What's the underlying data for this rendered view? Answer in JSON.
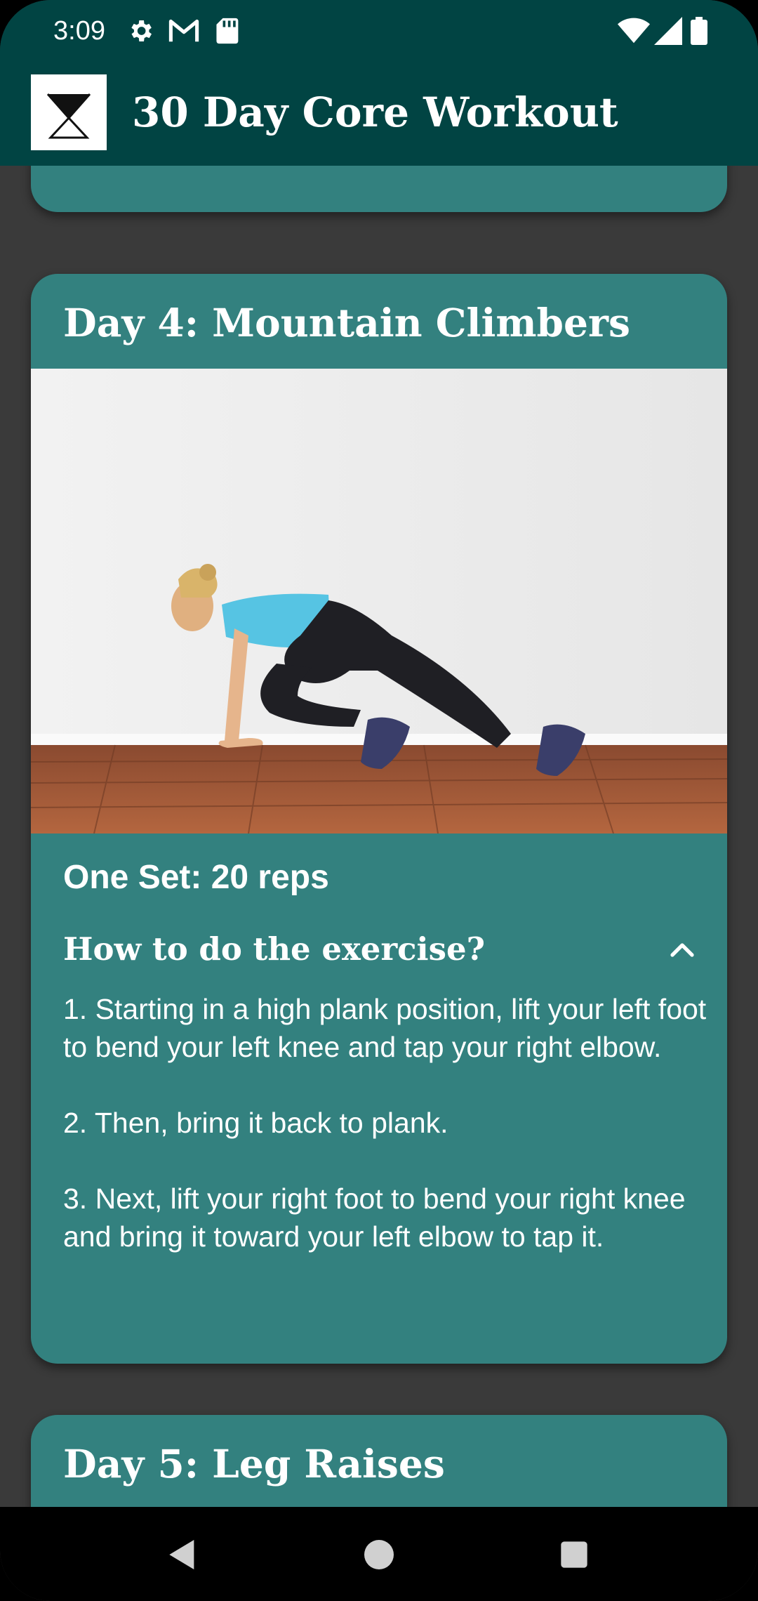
{
  "status_bar": {
    "time": "3:09",
    "left_icons": [
      "gear-icon",
      "gmail-icon",
      "sd-card-icon"
    ],
    "right_icons": [
      "wifi-icon",
      "signal-icon",
      "battery-icon"
    ]
  },
  "app_bar": {
    "title": "30 Day Core Workout",
    "logo_icon": "app-logo-icon",
    "background": "#014443"
  },
  "cards": [
    {
      "title": "Day 4: Mountain Climbers",
      "image": "woman-doing-mountain-climbers-photo",
      "sets": "One Set: 20 reps",
      "howto_label": "How to do the exercise?",
      "expanded": true,
      "steps": [
        "1. Starting in a high plank position, lift your left foot to bend your left knee and tap your right elbow.",
        "2. Then, bring it back to plank.",
        "3. Next, lift your right foot to bend your right knee and bring it toward your left elbow to tap it."
      ]
    },
    {
      "title": "Day 5: Leg Raises"
    }
  ],
  "colors": {
    "card": "#33817f",
    "background": "#3a3a3a",
    "text": "#ffffff"
  },
  "nav_bar": {
    "buttons": [
      "back-icon",
      "home-icon",
      "recents-icon"
    ]
  }
}
